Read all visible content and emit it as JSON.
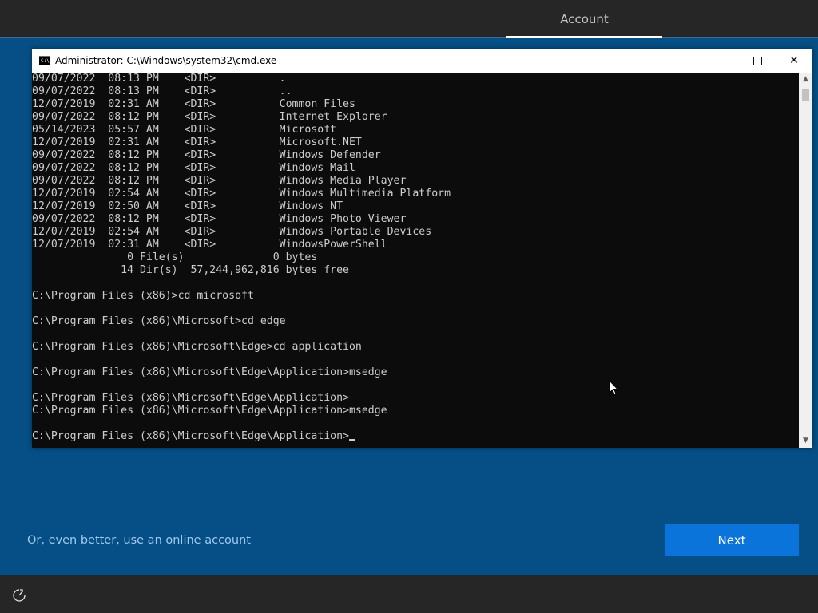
{
  "header": {
    "tab_label": "Account"
  },
  "cmd_window": {
    "title": "Administrator: C:\\Windows\\system32\\cmd.exe",
    "icon": "console-icon",
    "icon_text": "C:\\",
    "lines": [
      "09/07/2022  08:13 PM    <DIR>          .",
      "09/07/2022  08:13 PM    <DIR>          ..",
      "12/07/2019  02:31 AM    <DIR>          Common Files",
      "09/07/2022  08:12 PM    <DIR>          Internet Explorer",
      "05/14/2023  05:57 AM    <DIR>          Microsoft",
      "12/07/2019  02:31 AM    <DIR>          Microsoft.NET",
      "09/07/2022  08:12 PM    <DIR>          Windows Defender",
      "09/07/2022  08:12 PM    <DIR>          Windows Mail",
      "09/07/2022  08:12 PM    <DIR>          Windows Media Player",
      "12/07/2019  02:54 AM    <DIR>          Windows Multimedia Platform",
      "12/07/2019  02:50 AM    <DIR>          Windows NT",
      "09/07/2022  08:12 PM    <DIR>          Windows Photo Viewer",
      "12/07/2019  02:54 AM    <DIR>          Windows Portable Devices",
      "12/07/2019  02:31 AM    <DIR>          WindowsPowerShell",
      "               0 File(s)              0 bytes",
      "              14 Dir(s)  57,244,962,816 bytes free",
      "",
      "C:\\Program Files (x86)>cd microsoft",
      "",
      "C:\\Program Files (x86)\\Microsoft>cd edge",
      "",
      "C:\\Program Files (x86)\\Microsoft\\Edge>cd application",
      "",
      "C:\\Program Files (x86)\\Microsoft\\Edge\\Application>msedge",
      "",
      "C:\\Program Files (x86)\\Microsoft\\Edge\\Application>",
      "C:\\Program Files (x86)\\Microsoft\\Edge\\Application>msedge",
      ""
    ],
    "prompt": "C:\\Program Files (x86)\\Microsoft\\Edge\\Application>"
  },
  "footer": {
    "online_account_link": "Or, even better, use an online account",
    "next_button": "Next",
    "accessibility_icon": "ease-of-access-icon"
  }
}
